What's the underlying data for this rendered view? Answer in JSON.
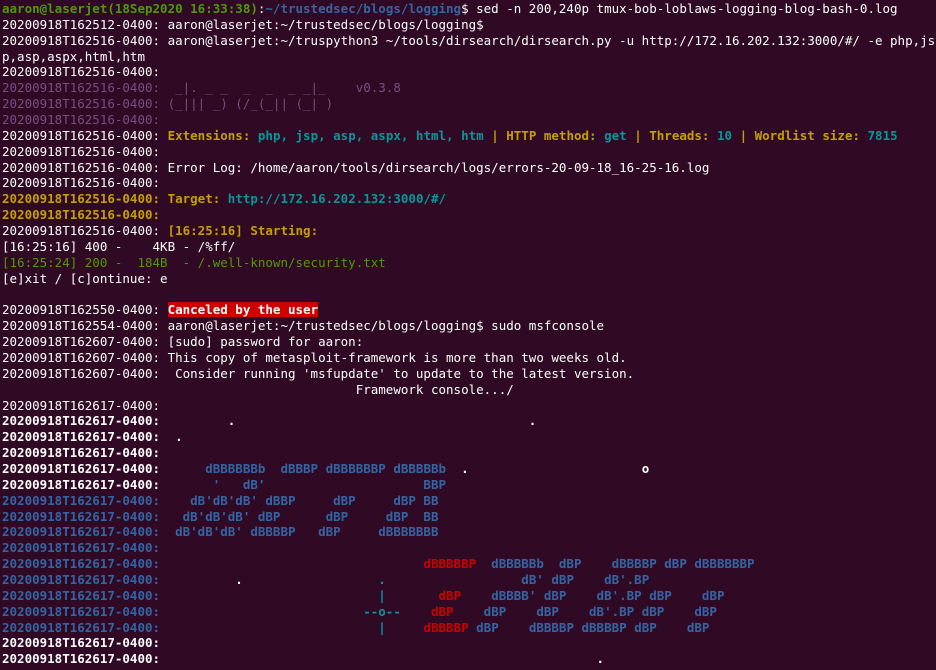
{
  "colors": {
    "background": "#300a24",
    "default": "#ffffff",
    "prompt_green": "#4e9a06",
    "path_blue": "#3465a4",
    "magenta": "#75507b",
    "yellow": "#c4a000",
    "cyan": "#06989a",
    "red_bg": "#cc0000",
    "red": "#cc0000",
    "green_text": "#4e9a06"
  },
  "terminal": {
    "lines": [
      {
        "segs": [
          {
            "t": "aaron@laserjet(18Sep2020 16:33:38)",
            "c": "#4e9a06",
            "b": true
          },
          {
            "t": ":",
            "c": "#ffffff"
          },
          {
            "t": "~/trustedsec/blogs/logging",
            "c": "#3465a4",
            "b": true
          },
          {
            "t": "$ sed -n 200,240p tmux-bob-loblaws-logging-blog-bash-0.log",
            "c": "#ffffff"
          }
        ]
      },
      {
        "segs": [
          {
            "t": "20200918T162512-0400: aaron@laserjet:~/trustedsec/blogs/logging$",
            "c": "#ffffff"
          }
        ]
      },
      {
        "segs": [
          {
            "t": "20200918T162516-0400: aaron@laserjet:~/truspython3 ~/tools/dirsearch/dirsearch.py -u http://172.16.202.132:3000/#/ -e php,js",
            "c": "#ffffff"
          }
        ]
      },
      {
        "segs": [
          {
            "t": "p,asp,aspx,html,htm",
            "c": "#ffffff"
          }
        ]
      },
      {
        "segs": [
          {
            "t": "20200918T162516-0400:",
            "c": "#ffffff"
          }
        ]
      },
      {
        "segs": [
          {
            "t": "20200918T162516-0400:  _|. _ _  _  _  _ _|_    v0.3.8",
            "c": "#75507b"
          }
        ]
      },
      {
        "segs": [
          {
            "t": "20200918T162516-0400: (_||| _) (/_(_|| (_| )",
            "c": "#75507b"
          }
        ]
      },
      {
        "segs": [
          {
            "t": "20200918T162516-0400:",
            "c": "#75507b"
          }
        ]
      },
      {
        "segs": [
          {
            "t": "20200918T162516-0400: ",
            "c": "#ffffff"
          },
          {
            "t": "Extensions: ",
            "c": "#c4a000",
            "b": true
          },
          {
            "t": "php, jsp, asp, aspx, html, htm",
            "c": "#06989a",
            "b": true
          },
          {
            "t": " | ",
            "c": "#c4a000",
            "b": true
          },
          {
            "t": "HTTP method: ",
            "c": "#c4a000",
            "b": true
          },
          {
            "t": "get",
            "c": "#06989a",
            "b": true
          },
          {
            "t": " | ",
            "c": "#c4a000",
            "b": true
          },
          {
            "t": "Threads: ",
            "c": "#c4a000",
            "b": true
          },
          {
            "t": "10",
            "c": "#06989a",
            "b": true
          },
          {
            "t": " | ",
            "c": "#c4a000",
            "b": true
          },
          {
            "t": "Wordlist size: ",
            "c": "#c4a000",
            "b": true
          },
          {
            "t": "7815",
            "c": "#06989a",
            "b": true
          }
        ]
      },
      {
        "segs": [
          {
            "t": "20200918T162516-0400:",
            "c": "#ffffff"
          }
        ]
      },
      {
        "segs": [
          {
            "t": "20200918T162516-0400: Error Log: /home/aaron/tools/dirsearch/logs/errors-20-09-18_16-25-16.log",
            "c": "#ffffff"
          }
        ]
      },
      {
        "segs": [
          {
            "t": "20200918T162516-0400:",
            "c": "#ffffff"
          }
        ]
      },
      {
        "segs": [
          {
            "t": "20200918T162516-0400: ",
            "c": "#c4a000",
            "b": true
          },
          {
            "t": "Target: ",
            "c": "#c4a000",
            "b": true
          },
          {
            "t": "http://172.16.202.132:3000/#/",
            "c": "#06989a",
            "b": true
          }
        ]
      },
      {
        "segs": [
          {
            "t": "20200918T162516-0400:",
            "c": "#c4a000",
            "b": true
          }
        ]
      },
      {
        "segs": [
          {
            "t": "20200918T162516-0400: ",
            "c": "#ffffff"
          },
          {
            "t": "[16:25:16] Starting:",
            "c": "#c4a000",
            "b": true
          }
        ]
      },
      {
        "segs": [
          {
            "t": "[16:25:16] 400 -    4KB - /%ff/",
            "c": "#ffffff"
          }
        ]
      },
      {
        "segs": [
          {
            "t": "[16:25:24] 200 -  184B  - /.well-known/security.txt",
            "c": "#4e9a06"
          }
        ]
      },
      {
        "segs": [
          {
            "t": "[e]xit / [c]ontinue: e",
            "c": "#ffffff"
          }
        ]
      },
      {
        "segs": [
          {
            "t": "",
            "c": "#ffffff"
          }
        ]
      },
      {
        "segs": [
          {
            "t": "20200918T162550-0400: ",
            "c": "#ffffff"
          },
          {
            "t": "Canceled by the user",
            "c": "#ffffff",
            "b": true,
            "bg": "#cc0000"
          }
        ]
      },
      {
        "segs": [
          {
            "t": "20200918T162554-0400: aaron@laserjet:~/trustedsec/blogs/logging$ sudo msfconsole",
            "c": "#ffffff"
          }
        ]
      },
      {
        "segs": [
          {
            "t": "20200918T162607-0400: [sudo] password for aaron:",
            "c": "#ffffff"
          }
        ]
      },
      {
        "segs": [
          {
            "t": "20200918T162607-0400: This copy of metasploit-framework is more than two weeks old.",
            "c": "#ffffff"
          }
        ]
      },
      {
        "segs": [
          {
            "t": "20200918T162607-0400:  Consider running 'msfupdate' to update to the latest version.",
            "c": "#ffffff"
          }
        ]
      },
      {
        "segs": [
          {
            "t": "                                               Framework console.../",
            "c": "#ffffff"
          }
        ]
      },
      {
        "segs": [
          {
            "t": "20200918T162617-0400:",
            "c": "#ffffff"
          }
        ]
      },
      {
        "segs": [
          {
            "t": "20200918T162617-0400:         .                                       .",
            "c": "#ffffff",
            "b": true
          }
        ]
      },
      {
        "segs": [
          {
            "t": "20200918T162617-0400:  .",
            "c": "#ffffff",
            "b": true
          }
        ]
      },
      {
        "segs": [
          {
            "t": "20200918T162617-0400:",
            "c": "#ffffff",
            "b": true
          }
        ]
      },
      {
        "segs": [
          {
            "t": "20200918T162617-0400:      ",
            "c": "#ffffff",
            "b": true
          },
          {
            "t": "dBBBBBBb  dBBBP dBBBBBBP dBBBBBb",
            "c": "#3465a4",
            "b": true
          },
          {
            "t": "  .                       o",
            "c": "#ffffff",
            "b": true
          }
        ]
      },
      {
        "segs": [
          {
            "t": "20200918T162617-0400:       ",
            "c": "#ffffff",
            "b": true
          },
          {
            "t": "'   dB'                     BBP",
            "c": "#3465a4",
            "b": true
          }
        ]
      },
      {
        "segs": [
          {
            "t": "20200918T162617-0400:    dB'dB'dB' dBBP     dBP     dBP BB",
            "c": "#3465a4",
            "b": true
          }
        ]
      },
      {
        "segs": [
          {
            "t": "20200918T162617-0400:   dB'dB'dB' dBP      dBP     dBP  BB",
            "c": "#3465a4",
            "b": true
          }
        ]
      },
      {
        "segs": [
          {
            "t": "20200918T162617-0400:  dB'dB'dB' dBBBBP   dBP     dBBBBBBB",
            "c": "#3465a4",
            "b": true
          }
        ]
      },
      {
        "segs": [
          {
            "t": "20200918T162617-0400:",
            "c": "#3465a4",
            "b": true
          }
        ]
      },
      {
        "segs": [
          {
            "t": "20200918T162617-0400:                                   ",
            "c": "#3465a4",
            "b": true
          },
          {
            "t": "dBBBBBP",
            "c": "#cc0000",
            "b": true
          },
          {
            "t": "  dBBBBBb  dBP    dBBBBP dBP dBBBBBBP",
            "c": "#3465a4",
            "b": true
          }
        ]
      },
      {
        "segs": [
          {
            "t": "20200918T162617-0400:          ",
            "c": "#3465a4",
            "b": true
          },
          {
            "t": ".",
            "c": "#ffffff",
            "b": true
          },
          {
            "t": "                  ",
            "c": "#3465a4",
            "b": true
          },
          {
            "t": ".",
            "c": "#06989a",
            "b": true
          },
          {
            "t": "                  dB' dBP    dB'.BP",
            "c": "#3465a4",
            "b": true
          }
        ]
      },
      {
        "segs": [
          {
            "t": "20200918T162617-0400:                             ",
            "c": "#3465a4",
            "b": true
          },
          {
            "t": "|",
            "c": "#06989a",
            "b": true
          },
          {
            "t": "       ",
            "c": "#3465a4",
            "b": true
          },
          {
            "t": "dBP",
            "c": "#cc0000",
            "b": true
          },
          {
            "t": "    dBBBB' dBP    dB'.BP dBP    dBP",
            "c": "#3465a4",
            "b": true
          }
        ]
      },
      {
        "segs": [
          {
            "t": "20200918T162617-0400:                           ",
            "c": "#3465a4",
            "b": true
          },
          {
            "t": "--o--",
            "c": "#06989a",
            "b": true
          },
          {
            "t": "    ",
            "c": "#3465a4",
            "b": true
          },
          {
            "t": "dBP",
            "c": "#cc0000",
            "b": true
          },
          {
            "t": "    dBP    dBP    dB'.BP dBP    dBP",
            "c": "#3465a4",
            "b": true
          }
        ]
      },
      {
        "segs": [
          {
            "t": "20200918T162617-0400:                             ",
            "c": "#3465a4",
            "b": true
          },
          {
            "t": "|",
            "c": "#06989a",
            "b": true
          },
          {
            "t": "     ",
            "c": "#3465a4",
            "b": true
          },
          {
            "t": "dBBBBP",
            "c": "#cc0000",
            "b": true
          },
          {
            "t": " dBP    dBBBBP dBBBBP dBP    dBP",
            "c": "#3465a4",
            "b": true
          }
        ]
      },
      {
        "segs": [
          {
            "t": "20200918T162617-0400:",
            "c": "#ffffff",
            "b": true
          }
        ]
      },
      {
        "segs": [
          {
            "t": "20200918T162617-0400:                                                          .",
            "c": "#ffffff",
            "b": true
          }
        ]
      }
    ]
  }
}
